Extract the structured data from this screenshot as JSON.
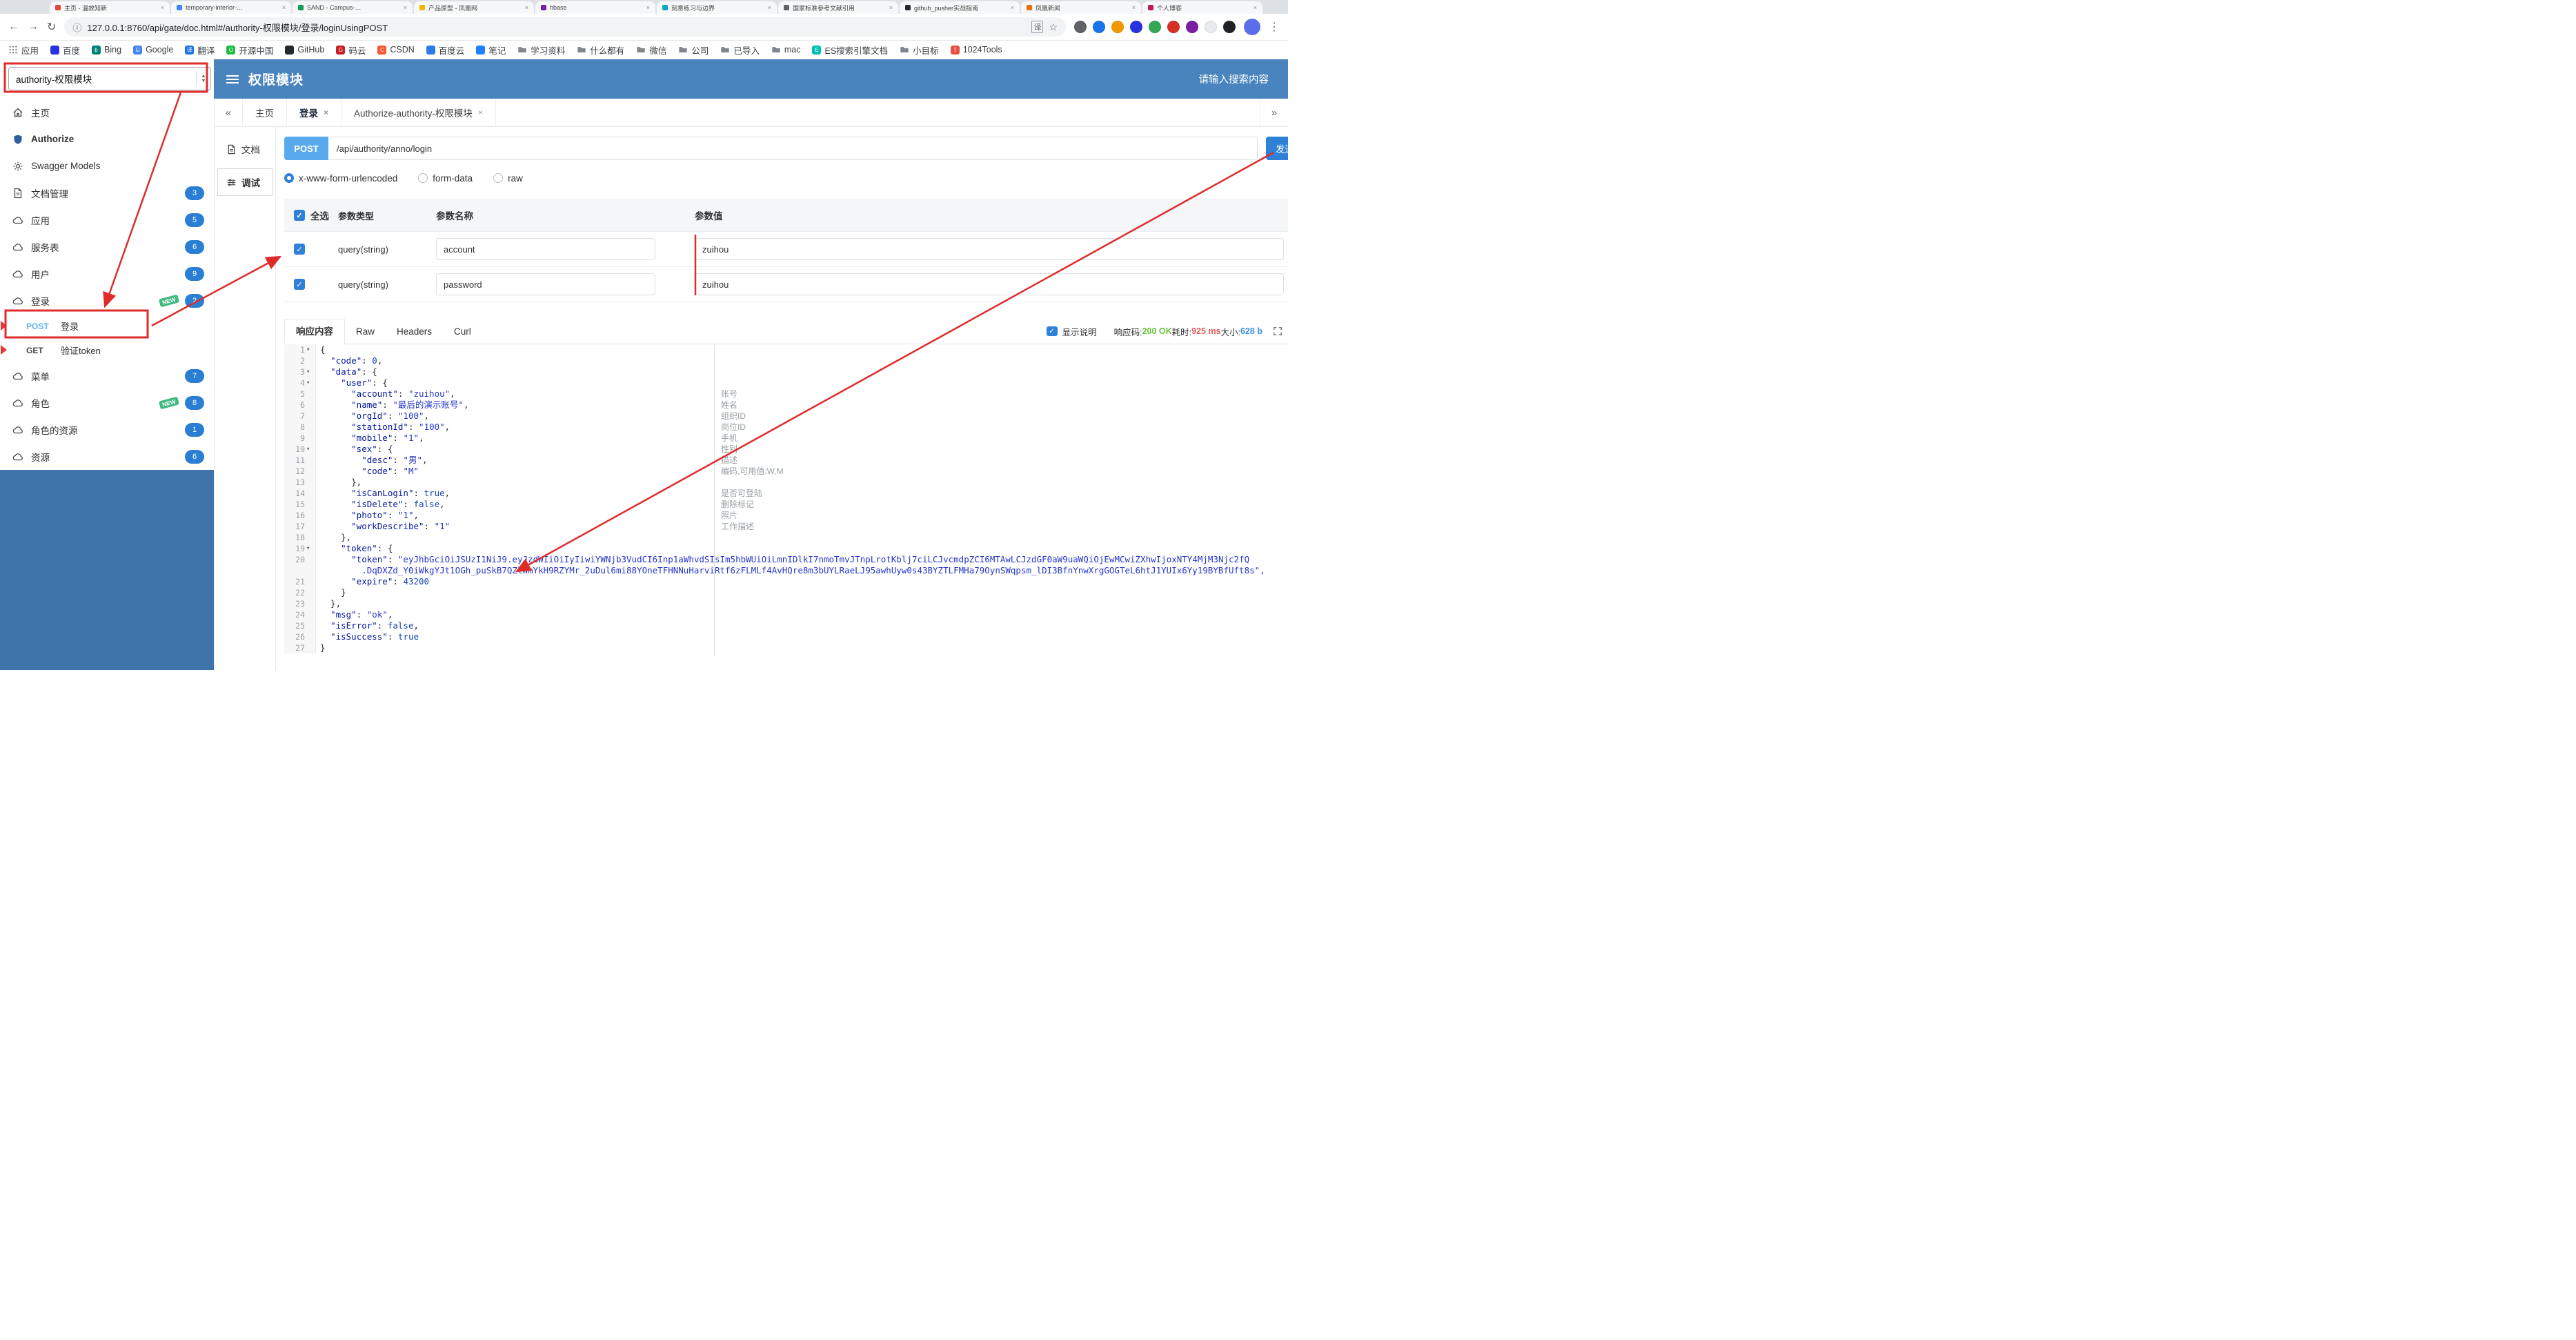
{
  "browser": {
    "tabs": [
      {
        "label": "主页 - 温故知新",
        "color": "#e8453c"
      },
      {
        "label": "temporary-interior-…",
        "color": "#4285f4"
      },
      {
        "label": "SAND - Campus-…",
        "color": "#0f9d58"
      },
      {
        "label": "产品原型 - 凤凰网",
        "color": "#f4b400"
      },
      {
        "label": "hbase",
        "color": "#7b1fa2"
      },
      {
        "label": "刻意练习与边界",
        "color": "#00acc1"
      },
      {
        "label": "国家标准参考文献引用",
        "color": "#5f6368"
      },
      {
        "label": "github_pusher实战指南",
        "color": "#24292e"
      },
      {
        "label": "凤凰新闻",
        "color": "#ef6c00"
      },
      {
        "label": "个人博客",
        "color": "#c2185b"
      }
    ],
    "address": {
      "url": "127.0.0.1:8760/api/gate/doc.html#/authority-权限模块/登录/loginUsingPOST"
    },
    "extensions": [
      "#5f6368",
      "#1a73e8",
      "#f29900",
      "#2932e1",
      "#34a853",
      "#d93025",
      "#7b1fa2",
      "#e8eaed",
      "#202124"
    ],
    "bookmarks": [
      {
        "icon": "grid",
        "label": "应用"
      },
      {
        "icon": "dot",
        "color": "#2932e1",
        "letter": "",
        "label": "百度"
      },
      {
        "icon": "dot",
        "color": "#008373",
        "letter": "b",
        "label": "Bing"
      },
      {
        "icon": "dot",
        "color": "#4285f4",
        "letter": "G",
        "label": "Google"
      },
      {
        "icon": "dot",
        "color": "#1a73e8",
        "letter": "译",
        "label": "翻译"
      },
      {
        "icon": "dot",
        "color": "#21ba45",
        "letter": "O",
        "label": "开源中国"
      },
      {
        "icon": "dot",
        "color": "#24292e",
        "letter": "",
        "label": "GitHub"
      },
      {
        "icon": "dot",
        "color": "#c71d23",
        "letter": "G",
        "label": "码云"
      },
      {
        "icon": "dot",
        "color": "#fc5531",
        "letter": "C",
        "label": "CSDN"
      },
      {
        "icon": "dot",
        "color": "#2b7ce9",
        "letter": "",
        "label": "百度云"
      },
      {
        "icon": "dot",
        "color": "#1e80ff",
        "letter": "",
        "label": "笔记"
      },
      {
        "icon": "folder",
        "label": "学习资料"
      },
      {
        "icon": "folder",
        "label": "什么都有"
      },
      {
        "icon": "folder",
        "label": "微信"
      },
      {
        "icon": "folder",
        "label": "公司"
      },
      {
        "icon": "folder",
        "label": "已导入"
      },
      {
        "icon": "folder",
        "label": "mac"
      },
      {
        "icon": "dot",
        "color": "#00bfb3",
        "letter": "E",
        "label": "ES搜索引擎文档"
      },
      {
        "icon": "folder",
        "label": "小目标"
      },
      {
        "icon": "dot",
        "color": "#e84e40",
        "letter": "T",
        "label": "1024Tools"
      }
    ]
  },
  "header": {
    "module_select": "authority-权限模块",
    "title": "权限模块",
    "search_placeholder": "请输入搜索内容"
  },
  "sidebar": {
    "new_label": "NEW",
    "items": [
      {
        "icon": "home",
        "label": "主页"
      },
      {
        "icon": "shield",
        "label": "Authorize",
        "bold": true
      },
      {
        "icon": "gear",
        "label": "Swagger Models"
      },
      {
        "icon": "doc",
        "label": "文档管理",
        "badge": "3"
      },
      {
        "icon": "cloud",
        "label": "应用",
        "badge": "5"
      },
      {
        "icon": "cloud",
        "label": "服务表",
        "badge": "6"
      },
      {
        "icon": "cloud",
        "label": "用户",
        "badge": "9"
      },
      {
        "icon": "cloud",
        "label": "登录",
        "badge": "2",
        "new": true
      },
      {
        "type": "sub",
        "method": "POST",
        "label": "登录",
        "selected": true
      },
      {
        "type": "sub",
        "method": "GET",
        "label": "验证token"
      },
      {
        "icon": "cloud",
        "label": "菜单",
        "badge": "7"
      },
      {
        "icon": "cloud",
        "label": "角色",
        "badge": "8",
        "new": true
      },
      {
        "icon": "cloud",
        "label": "角色的资源",
        "badge": "1"
      },
      {
        "icon": "cloud",
        "label": "资源",
        "badge": "6"
      }
    ]
  },
  "tabs": {
    "items": [
      {
        "label": "主页",
        "closable": false,
        "active": false
      },
      {
        "label": "登录",
        "closable": true,
        "active": true
      },
      {
        "label": "Authorize-authority-权限模块",
        "closable": true,
        "active": false
      }
    ]
  },
  "doc_tabs": {
    "doc": "文档",
    "debug": "调试"
  },
  "debug": {
    "method": "POST",
    "url": "/api/authority/anno/login",
    "send_label": "发送",
    "content_types": [
      "x-www-form-urlencoded",
      "form-data",
      "raw"
    ],
    "selected_content_type": "x-www-form-urlencoded",
    "params_table": {
      "headers": [
        "全选",
        "参数类型",
        "参数名称",
        "参数值"
      ],
      "rows": [
        {
          "checked": true,
          "type": "query(string)",
          "name": "account",
          "value": "zuihou"
        },
        {
          "checked": true,
          "type": "query(string)",
          "name": "password",
          "value": "zuihou"
        }
      ]
    }
  },
  "response": {
    "tabs": [
      "响应内容",
      "Raw",
      "Headers",
      "Curl"
    ],
    "active_tab": "响应内容",
    "show_desc_label": "显示说明",
    "meta": {
      "code_label": "响应码:",
      "code": "200 OK",
      "time_label": "耗时:",
      "time": "925 ms",
      "size_label": "大小:",
      "size": "628 b"
    },
    "code_lines": [
      {
        "no": "1",
        "fold": true,
        "text": "{"
      },
      {
        "no": "2",
        "text": "  \"code\": 0,"
      },
      {
        "no": "3",
        "fold": true,
        "text": "  \"data\": {"
      },
      {
        "no": "4",
        "fold": true,
        "text": "    \"user\": {"
      },
      {
        "no": "5",
        "text": "      \"account\": \"zuihou\",",
        "desc": "账号"
      },
      {
        "no": "6",
        "text": "      \"name\": \"最后的演示账号\",",
        "desc": "姓名"
      },
      {
        "no": "7",
        "text": "      \"orgId\": \"100\",",
        "desc": "组织ID"
      },
      {
        "no": "8",
        "text": "      \"stationId\": \"100\",",
        "desc": "岗位ID"
      },
      {
        "no": "9",
        "text": "      \"mobile\": \"1\",",
        "desc": "手机"
      },
      {
        "no": "10",
        "fold": true,
        "text": "      \"sex\": {",
        "desc": "性别"
      },
      {
        "no": "11",
        "text": "        \"desc\": \"男\",",
        "desc": "描述"
      },
      {
        "no": "12",
        "text": "        \"code\": \"M\"",
        "desc": "编码,可用值:W,M"
      },
      {
        "no": "13",
        "text": "      },"
      },
      {
        "no": "14",
        "text": "      \"isCanLogin\": true,",
        "desc": "是否可登陆"
      },
      {
        "no": "15",
        "text": "      \"isDelete\": false,",
        "desc": "删除标记"
      },
      {
        "no": "16",
        "text": "      \"photo\": \"1\",",
        "desc": "照片"
      },
      {
        "no": "17",
        "text": "      \"workDescribe\": \"1\"",
        "desc": "工作描述"
      },
      {
        "no": "18",
        "text": "    },"
      },
      {
        "no": "19",
        "fold": true,
        "text": "    \"token\": {"
      },
      {
        "no": "20",
        "open": true,
        "text": "      \"token\": \"eyJhbGciOiJSUzI1NiJ9.eyJzdWIiOiIyIiwiYWNjb3VudCI6Inp1aWhvdSIsIm5hbWUiOiLmnIDlkI7nmoTmvJTnpLrotKblj7ciLCJvcmdpZCI6MTAwLCJzdGF0aW9uaWQiOjEwMCwiZXhwIjoxNTY4MjM3Njc2fQ"
      },
      {
        "no": "",
        "cls": "s",
        "text": "        .DqDXZd_Y0iWkgYJt1OGh_puSkB7QZlWmYkH9RZYMr_2uDul6mi88YOneTFHNNuHarviRtf6zFLMLf4AvHQre8m3bUYLRaeLJ95awhUyw0s43BYZTLFMHa79OynSWqpsm_lDI3BfnYnwXrgGOGTeL6htJ1YUIx6Yy19BYBfUft8s\","
      },
      {
        "no": "21",
        "text": "      \"expire\": 43200"
      },
      {
        "no": "22",
        "text": "    }"
      },
      {
        "no": "23",
        "text": "  },"
      },
      {
        "no": "24",
        "text": "  \"msg\": \"ok\","
      },
      {
        "no": "25",
        "text": "  \"isError\": false,"
      },
      {
        "no": "26",
        "text": "  \"isSuccess\": true"
      },
      {
        "no": "27",
        "text": "}"
      }
    ]
  }
}
